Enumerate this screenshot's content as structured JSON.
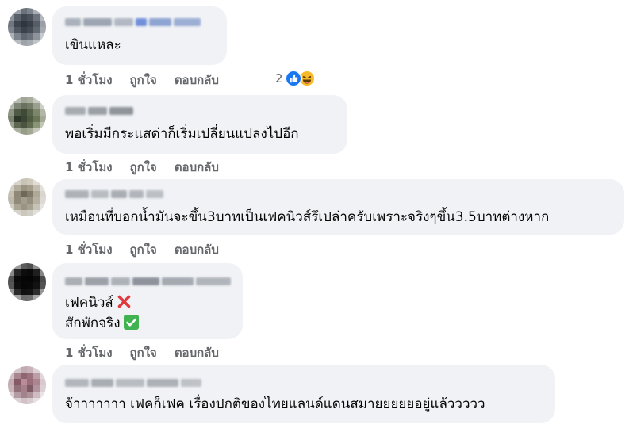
{
  "comments": [
    {
      "id": "c1",
      "text": "เขินแหละ",
      "time": "1 ชั่วโมง",
      "like_label": "ถูกใจ",
      "reply_label": "ตอบกลับ",
      "reaction_count": "2",
      "reactions": [
        "like-reaction-icon",
        "haha-reaction-icon"
      ]
    },
    {
      "id": "c2",
      "text": "พอเริ่มมีกระแสด่าก็เริ่มเปลี่ยนแปลงไปอีก",
      "time": "1 ชั่วโมง",
      "like_label": "ถูกใจ",
      "reply_label": "ตอบกลับ"
    },
    {
      "id": "c3",
      "text": "เหมือนที่บอกน้ำมันจะขึ้น3บาทเป็นเฟคนิวส์รึเปล่าครับเพราะจริงๆขึ้น3.5บาทต่างหาก",
      "time": "1 ชั่วโมง",
      "like_label": "ถูกใจ",
      "reply_label": "ตอบกลับ"
    },
    {
      "id": "c4",
      "line1": "เฟคนิวส์",
      "line2": "สักพักจริง",
      "line1_icon": "cross-mark-emoji-icon",
      "line2_icon": "check-mark-emoji-icon",
      "time": "1 ชั่วโมง",
      "like_label": "ถูกใจ",
      "reply_label": "ตอบกลับ"
    },
    {
      "id": "c5",
      "text": "จ้าาาาาาา เฟคก็เฟค เรื่องปกติของไทยแลนด์แดนสมายยยยยอยู่แล้ววววว"
    }
  ],
  "colors": {
    "bubble": "#f0f2f5",
    "action_text": "#65676b",
    "like_blue": "#1877f2",
    "haha_yellow": "#f7b928",
    "cross_red": "#e0393e",
    "check_green": "#3eb34f"
  }
}
